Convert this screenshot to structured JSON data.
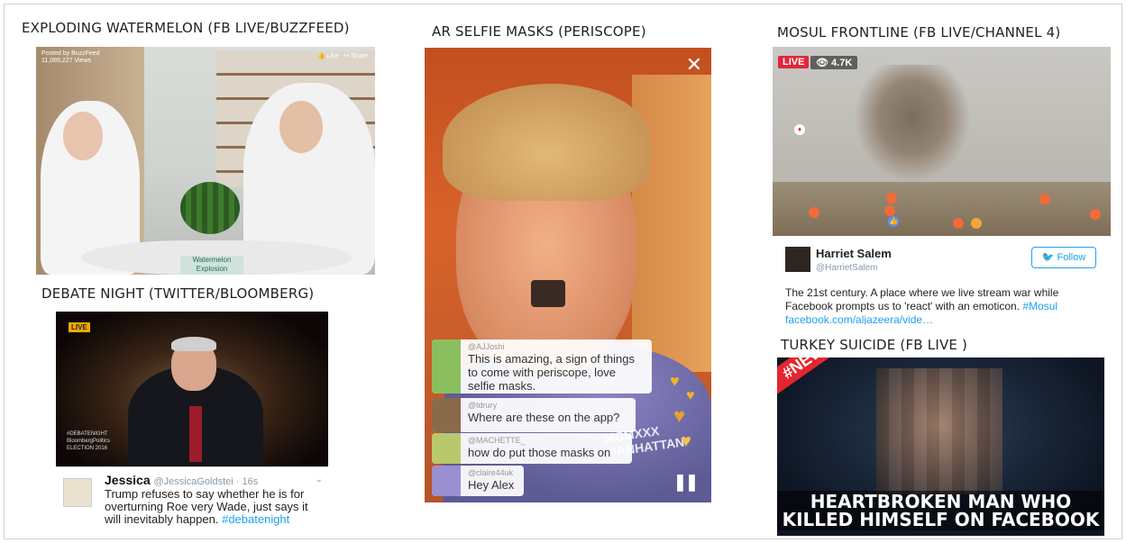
{
  "captions": {
    "watermelon": "EXPLODING WATERMELON  (FB LIVE/BUZZFEED)",
    "periscope": "AR SELFIE MASKS  (PERISCOPE)",
    "mosul": "MOSUL FRONTLINE (FB LIVE/CHANNEL 4)",
    "debate": "DEBATE NIGHT (TWITTER/BLOOMBERG)",
    "turkey": "TURKEY SUICIDE (FB LIVE )"
  },
  "watermelon": {
    "posted_by": "Posted by BuzzFeed",
    "views": "11,089,227 Views",
    "like": "Like",
    "share": "Share",
    "sign": "Watermelon Explosion"
  },
  "debate": {
    "live": "LIVE",
    "hashtag_overlay": "#DEBATENIGHT",
    "network_overlay": "BloombergPolitics",
    "election_overlay": "ELECTION 2016",
    "tweet_name": "Jessica",
    "tweet_handle": "@JessicaGoldstei · 16s",
    "tweet_text": "Trump refuses to say whether he is for overturning Roe very Wade, just says it will inevitably happen.",
    "tweet_hashtag": "#debatenight"
  },
  "periscope": {
    "comments": [
      {
        "user": "@AJJoshi",
        "text": "This is amazing, a sign of things to come with periscope, love selfie masks.",
        "avatar_color": "#8bbf5e"
      },
      {
        "user": "@tdrury",
        "text": "Where are these on the app?",
        "avatar_color": "#8a6a4a"
      },
      {
        "user": "@MACHETTE_",
        "text": "how do put those masks on",
        "avatar_color": "#b9c86a"
      },
      {
        "user": "@claire44uk",
        "text": "Hey Alex",
        "avatar_color": "#9a8fd0"
      }
    ],
    "shirt_text": "MCMXXX MANHATTAN"
  },
  "mosul": {
    "live": "LIVE",
    "views": "4.7K",
    "tweet_name": "Harriet Salem",
    "tweet_handle": "@HarrietSalem",
    "follow": "Follow",
    "tweet_text": "The 21st century. A place where we live stream war while Facebook prompts us to 'react' with an emoticon.",
    "tweet_hashtag": "#Mosul",
    "tweet_link": "facebook.com/aljazeera/vide…"
  },
  "turkey": {
    "badge": "#NEWS",
    "headline_line1": "HEARTBROKEN MAN WHO",
    "headline_line2": "KILLED HIMSELF ON FACEBOOK"
  }
}
